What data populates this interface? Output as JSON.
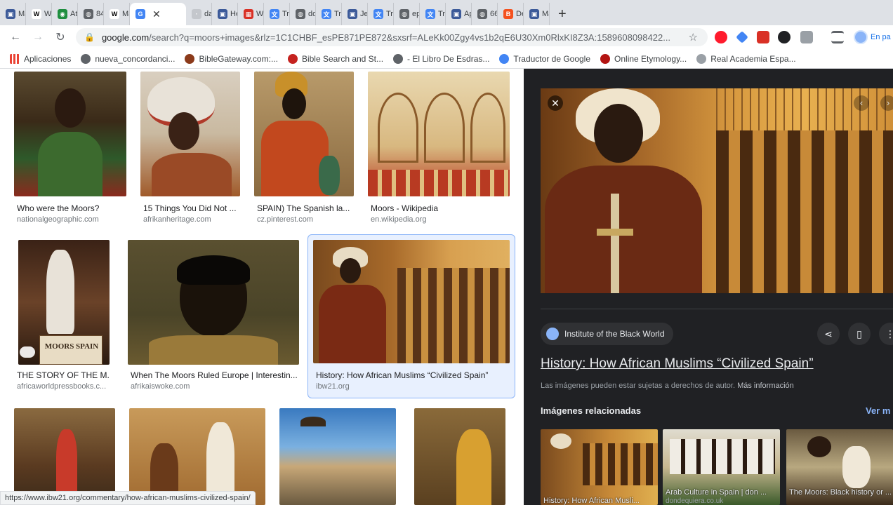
{
  "tabs": [
    {
      "label": "Ma",
      "color": "#3c5a99",
      "glyph": "▣"
    },
    {
      "label": "W",
      "color": "#fff",
      "glyph": "W",
      "text": "#000"
    },
    {
      "label": "Atl",
      "color": "#1e8e3e",
      "glyph": "◉"
    },
    {
      "label": "84",
      "color": "#5f6368",
      "glyph": "◍"
    },
    {
      "label": "Ma",
      "color": "#fff",
      "glyph": "W",
      "text": "#000"
    },
    {
      "label": "",
      "color": "#4285f4",
      "glyph": "G",
      "active": true
    },
    {
      "label": "dad",
      "color": "#c4c7cc",
      "glyph": "·"
    },
    {
      "label": "He",
      "color": "#3c5a99",
      "glyph": "▣"
    },
    {
      "label": "Wr",
      "color": "#d93025",
      "glyph": "▦"
    },
    {
      "label": "Tra",
      "color": "#4285f4",
      "glyph": "文"
    },
    {
      "label": "doc",
      "color": "#5f6368",
      "glyph": "◍"
    },
    {
      "label": "Tra",
      "color": "#4285f4",
      "glyph": "文"
    },
    {
      "label": "Jev",
      "color": "#3c5a99",
      "glyph": "▣"
    },
    {
      "label": "Tra",
      "color": "#4285f4",
      "glyph": "文"
    },
    {
      "label": "epi",
      "color": "#5f6368",
      "glyph": "◍"
    },
    {
      "label": "Tra",
      "color": "#4285f4",
      "glyph": "文"
    },
    {
      "label": "Ap",
      "color": "#3c5a99",
      "glyph": "▣"
    },
    {
      "label": "662",
      "color": "#5f6368",
      "glyph": "◍"
    },
    {
      "label": "De",
      "color": "#f4511e",
      "glyph": "B"
    },
    {
      "label": "Ma",
      "color": "#3c5a99",
      "glyph": "▣"
    }
  ],
  "toolbar": {
    "url_host": "google.com",
    "url_rest": "/search?q=moors+images&rlz=1C1CHBF_esPE871PE872&sxsrf=ALeKk00Zgy4vs1b2qE6U30Xm0RlxKI8Z3A:1589608098422...",
    "profile_label": "En pa"
  },
  "bookmarks": [
    {
      "label": "Aplicaciones",
      "color": "#ea4335"
    },
    {
      "label": "nueva_concordanci...",
      "color": "#5f6368"
    },
    {
      "label": "BibleGateway.com:...",
      "color": "#8b3a1a"
    },
    {
      "label": "Bible Search and St...",
      "color": "#c5221f"
    },
    {
      "label": "- El Libro De Esdras...",
      "color": "#5f6368"
    },
    {
      "label": "Traductor de Google",
      "color": "#4285f4"
    },
    {
      "label": "Online Etymology...",
      "color": "#b31412"
    },
    {
      "label": "Real Academia Espa...",
      "color": "#9aa0a6"
    }
  ],
  "results": [
    {
      "caption": "Who were the Moors?",
      "source": "nationalgeographic.com"
    },
    {
      "caption": "15 Things You Did Not ...",
      "source": "afrikanheritage.com"
    },
    {
      "caption": "SPAIN) The Spanish la...",
      "source": "cz.pinterest.com"
    },
    {
      "caption": "Moors - Wikipedia",
      "source": "en.wikipedia.org"
    },
    {
      "caption": "THE STORY OF THE M...",
      "source": "africaworldpressbooks.c..."
    },
    {
      "caption": "When The Moors Ruled Europe | Interestin...",
      "source": "afrikaiswoke.com"
    },
    {
      "caption": "History: How African Muslims “Civilized Spain”",
      "source": "ibw21.org"
    }
  ],
  "book_cover_text": "MOORS SPAIN",
  "status_url": "https://www.ibw21.org/commentary/how-african-muslims-civilized-spain/",
  "panel": {
    "site": "Institute of the Black World",
    "title": "History: How African Muslims “Civilized Spain”",
    "rights": "Las imágenes pueden estar sujetas a derechos de autor.",
    "more_info": "Más información",
    "related_heading": "Imágenes relacionadas",
    "see_more": "Ver m",
    "related": [
      {
        "caption": "History: How African Musli...",
        "source": ""
      },
      {
        "caption": "Arab Culture in Spain | don ...",
        "source": "dondequiera.co.uk"
      },
      {
        "caption": "The Moors: Black history or ...",
        "source": ""
      }
    ]
  }
}
